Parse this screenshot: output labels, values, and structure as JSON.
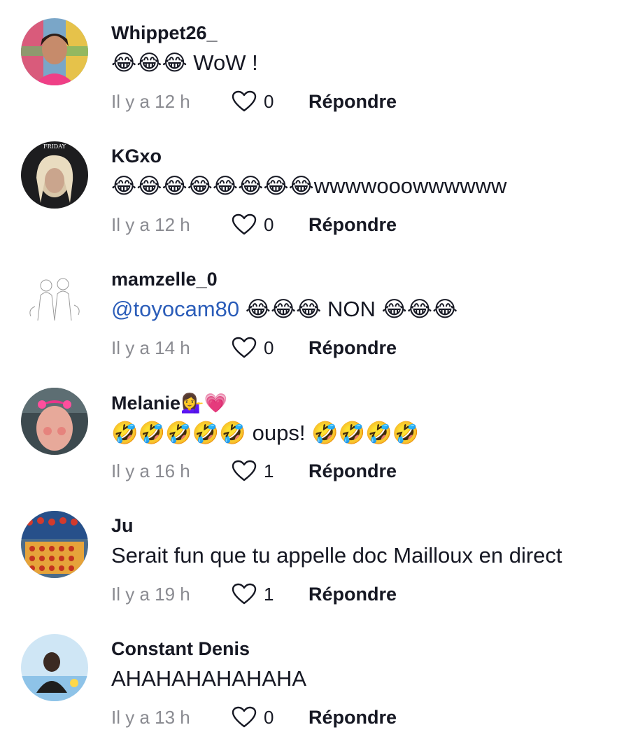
{
  "comments": [
    {
      "username": "Whippet26_",
      "text": "😂😂😂 WoW !",
      "time": "Il y a 12 h",
      "likes": "0",
      "reply": "Répondre"
    },
    {
      "username": "KGxo",
      "text": "😂😂😂😂😂😂😂😂wwwwooowwwwww",
      "time": "Il y a 12 h",
      "likes": "0",
      "reply": "Répondre"
    },
    {
      "username": "mamzelle_0",
      "mention": "@toyocam80",
      "text": " 😂😂😂 NON 😂😂😂",
      "time": "Il y a 14 h",
      "likes": "0",
      "reply": "Répondre"
    },
    {
      "username": "Melanie💁‍♀️💗",
      "text": "🤣🤣🤣🤣🤣 oups! 🤣🤣🤣🤣",
      "time": "Il y a 16 h",
      "likes": "1",
      "reply": "Répondre"
    },
    {
      "username": "Ju",
      "text": "Serait fun que tu appelle doc Mailloux en direct",
      "time": "Il y a 19 h",
      "likes": "1",
      "reply": "Répondre"
    },
    {
      "username": "Constant Denis",
      "text": "AHAHAHAHAHAHA",
      "time": "Il y a 13 h",
      "likes": "0",
      "reply": "Répondre"
    }
  ],
  "icons": {
    "like": "heart-outline-icon"
  }
}
